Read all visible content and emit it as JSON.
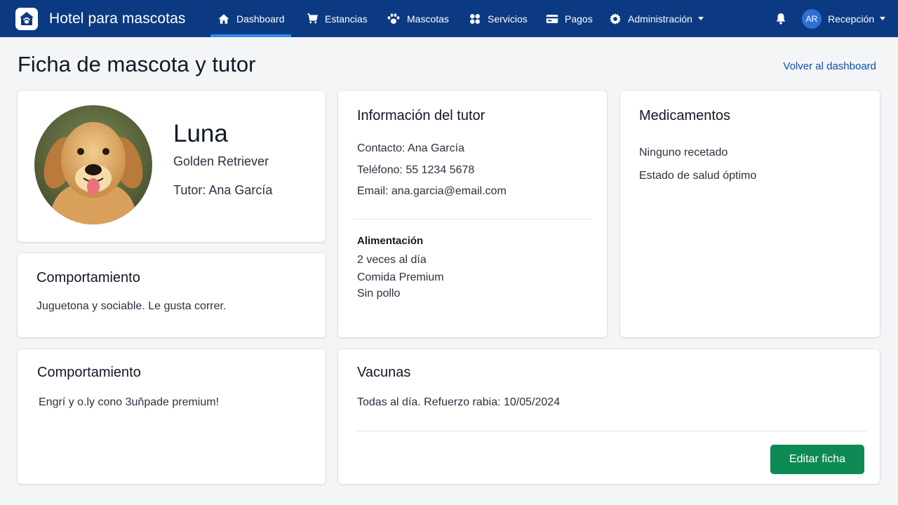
{
  "app": {
    "brand": "Hotel para mascotas",
    "brand_color": "#0b3a82",
    "icon": "paw-house-icon"
  },
  "nav": {
    "items": [
      {
        "label": "Dashboard",
        "icon": "home-icon",
        "active": true
      },
      {
        "label": "Estancias",
        "icon": "cart-icon"
      },
      {
        "label": "Mascotas",
        "icon": "paw-icon"
      },
      {
        "label": "Servicios",
        "icon": "services-icon"
      },
      {
        "label": "Pagos",
        "icon": "payment-card-icon"
      },
      {
        "label": "Administración",
        "icon": "gear-icon",
        "has_dropdown": true
      }
    ],
    "notifications_icon": "bell-icon",
    "user": {
      "initials": "AR",
      "label": "Recepción"
    }
  },
  "page": {
    "title": "Ficha de mascota y tutor",
    "back_link": "Volver al dashboard"
  },
  "pet": {
    "name": "Luna",
    "breed": "Golden Retriever",
    "owner_line": "Tutor: Ana García"
  },
  "behavior_1": {
    "title": "Comportamiento",
    "text": "Juguetona y sociable. Le gusta correr."
  },
  "behavior_2": {
    "title": "Comportamiento",
    "text": "Engrí y o.ly cono 3uňpade premium!"
  },
  "tutor": {
    "title": "Información del tutor",
    "contact": "Contacto: Ana García",
    "phone": "Teléfono: 55 1234 5678",
    "email": "Email: ana.garcia@email.com",
    "feeding_title": "Alimentación",
    "feeding_lines": [
      "2 veces al día",
      "Comida Premium",
      "Sin pollo"
    ]
  },
  "medications": {
    "title": "Medicamentos",
    "lines": [
      "Ninguno recetado",
      "Estado de salud óptimo"
    ]
  },
  "vaccines": {
    "title": "Vacunas",
    "text": "Todas al día. Refuerzo rabia: 10/05/2024"
  },
  "actions": {
    "edit_label": "Editar ficha",
    "edit_color": "#0e8a55"
  }
}
